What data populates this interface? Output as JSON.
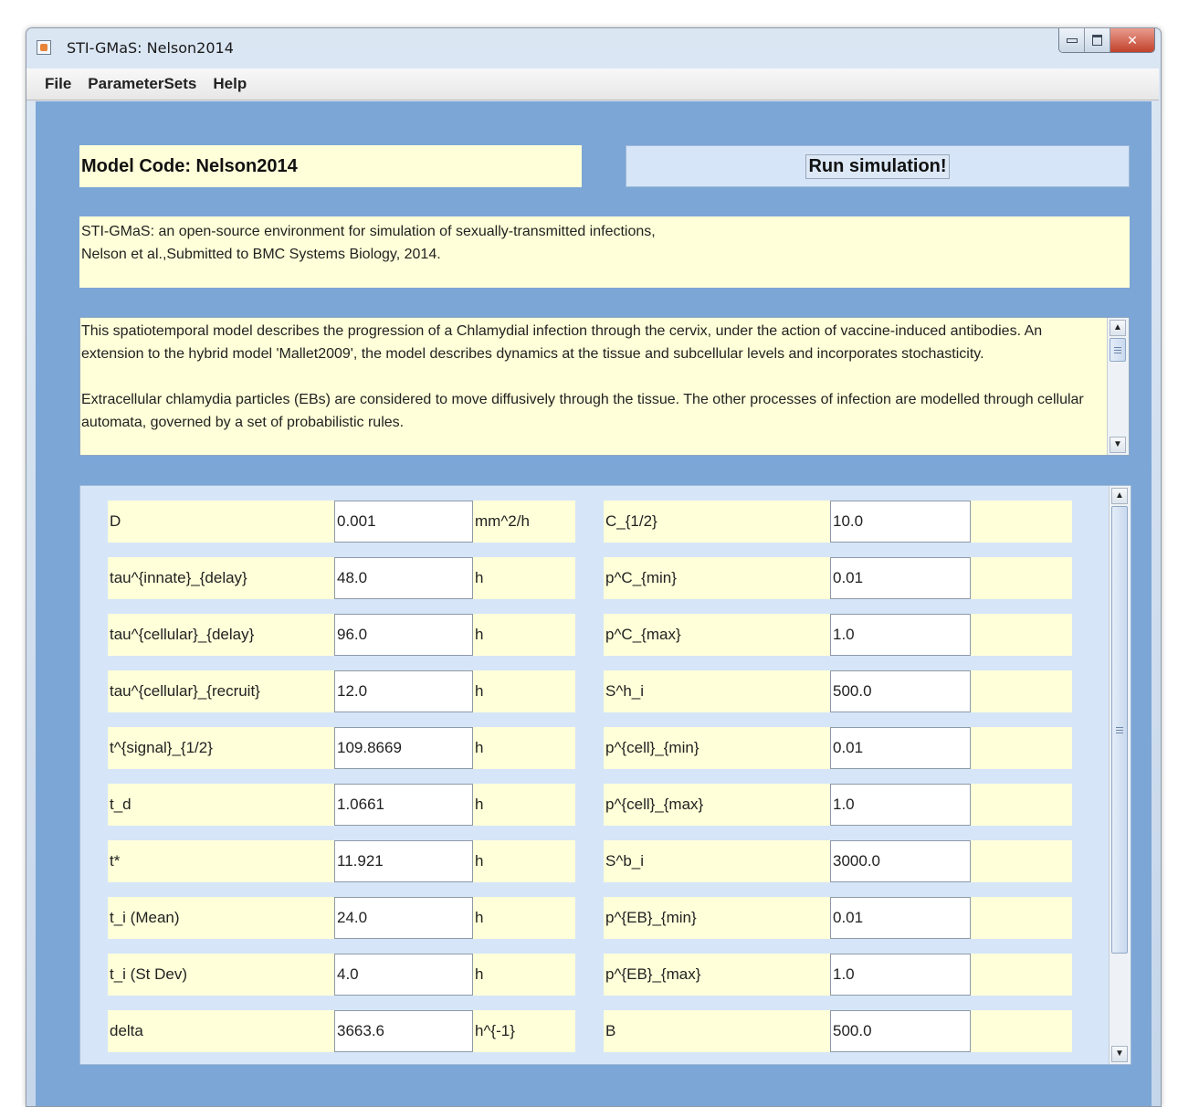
{
  "window": {
    "title": "STI-GMaS: Nelson2014",
    "icon": "java-app-icon",
    "close_glyph": "✕"
  },
  "menu": {
    "items": [
      "File",
      "ParameterSets",
      "Help"
    ]
  },
  "model_code": "Model Code: Nelson2014",
  "run_button": "Run simulation!",
  "citation": {
    "line1": "STI-GMaS: an open-source environment for simulation of sexually-transmitted infections,",
    "line2": "Nelson et al.,Submitted to BMC Systems Biology, 2014."
  },
  "description": {
    "paragraph1": "This spatiotemporal model describes the progression of a Chlamydial infection through the cervix, under the action of vaccine-induced antibodies. An extension to the hybrid model 'Mallet2009', the model describes dynamics at the tissue and subcellular levels and incorporates stochasticity.",
    "paragraph2": "Extracellular chlamydia particles (EBs) are considered to move diffusively through the tissue. The other processes of infection are modelled through cellular automata, governed by a set of probabilistic rules."
  },
  "parameters": [
    {
      "left": {
        "name": "D",
        "value": "0.001",
        "unit": "mm^2/h"
      },
      "right": {
        "name": "C_{1/2}",
        "value": "10.0",
        "unit": ""
      }
    },
    {
      "left": {
        "name": "tau^{innate}_{delay}",
        "value": "48.0",
        "unit": "h"
      },
      "right": {
        "name": "p^C_{min}",
        "value": "0.01",
        "unit": ""
      }
    },
    {
      "left": {
        "name": "tau^{cellular}_{delay}",
        "value": "96.0",
        "unit": "h"
      },
      "right": {
        "name": "p^C_{max}",
        "value": "1.0",
        "unit": ""
      }
    },
    {
      "left": {
        "name": "tau^{cellular}_{recruit}",
        "value": "12.0",
        "unit": "h"
      },
      "right": {
        "name": "S^h_i",
        "value": "500.0",
        "unit": ""
      }
    },
    {
      "left": {
        "name": "t^{signal}_{1/2}",
        "value": "109.8669",
        "unit": "h"
      },
      "right": {
        "name": "p^{cell}_{min}",
        "value": "0.01",
        "unit": ""
      }
    },
    {
      "left": {
        "name": "t_d",
        "value": "1.0661",
        "unit": "h"
      },
      "right": {
        "name": "p^{cell}_{max}",
        "value": "1.0",
        "unit": ""
      }
    },
    {
      "left": {
        "name": "t*",
        "value": "11.921",
        "unit": "h"
      },
      "right": {
        "name": "S^b_i",
        "value": "3000.0",
        "unit": ""
      }
    },
    {
      "left": {
        "name": "t_i (Mean)",
        "value": "24.0",
        "unit": "h"
      },
      "right": {
        "name": "p^{EB}_{min}",
        "value": "0.01",
        "unit": ""
      }
    },
    {
      "left": {
        "name": "t_i (St Dev)",
        "value": "4.0",
        "unit": "h"
      },
      "right": {
        "name": "p^{EB}_{max}",
        "value": "1.0",
        "unit": ""
      }
    },
    {
      "left": {
        "name": "delta",
        "value": "3663.6",
        "unit": "h^{-1}"
      },
      "right": {
        "name": "B",
        "value": "500.0",
        "unit": ""
      }
    }
  ],
  "scroll": {
    "up_glyph": "▲",
    "down_glyph": "▼"
  },
  "colors": {
    "content_bg": "#7ba6d6",
    "text_panel": "#ffffd9",
    "run_panel": "#d6e6f8"
  }
}
